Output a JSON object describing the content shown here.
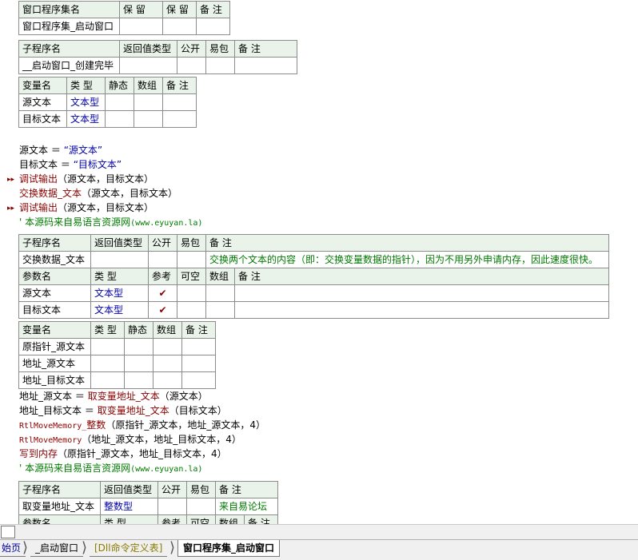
{
  "set_table": {
    "headers": [
      "窗口程序集名",
      "保 留",
      "保 留",
      "备 注"
    ],
    "row": [
      "窗口程序集_启动窗口",
      "",
      "",
      ""
    ]
  },
  "sub1": {
    "headers": [
      "子程序名",
      "返回值类型",
      "公开",
      "易包",
      "备 注"
    ],
    "row": [
      "__启动窗口_创建完毕",
      "",
      "",
      "",
      ""
    ],
    "var_headers": [
      "变量名",
      "类 型",
      "静态",
      "数组",
      "备 注"
    ],
    "vars": [
      {
        "name": "源文本",
        "type": "文本型"
      },
      {
        "name": "目标文本",
        "type": "文本型"
      }
    ]
  },
  "code1": [
    {
      "lhs": "源文本",
      "op": "＝",
      "rhs": "“源文本”"
    },
    {
      "lhs": "目标文本",
      "op": "＝",
      "rhs": "“目标文本”"
    },
    {
      "call": "调试输出",
      "args": "（源文本，目标文本）"
    },
    {
      "call": "交换数据_文本",
      "args": "（源文本，目标文本）"
    },
    {
      "call": "调试输出",
      "args": "（源文本，目标文本）"
    }
  ],
  "comment1": {
    "prefix": "' 本源码来自易语言资源网",
    "url": "(www.eyuyan.la)"
  },
  "sub2": {
    "headers": [
      "子程序名",
      "返回值类型",
      "公开",
      "易包",
      "备 注"
    ],
    "row": [
      "交换数据_文本",
      "",
      "",
      "",
      "交换两个文本的内容（即：交换变量数据的指针），因为不用另外申请内存，因此速度很快。"
    ],
    "param_headers": [
      "参数名",
      "类 型",
      "参考",
      "可空",
      "数组",
      "备 注"
    ],
    "params": [
      {
        "name": "源文本",
        "type": "文本型",
        "ref": "✔"
      },
      {
        "name": "目标文本",
        "type": "文本型",
        "ref": "✔"
      }
    ],
    "var_headers": [
      "变量名",
      "类 型",
      "静态",
      "数组",
      "备 注"
    ],
    "vars": [
      "原指针_源文本",
      "地址_源文本",
      "地址_目标文本"
    ]
  },
  "code2": [
    {
      "lhs": "地址_源文本",
      "op": "＝",
      "call": "取变量地址_文本",
      "args": "（源文本）"
    },
    {
      "lhs": "地址_目标文本",
      "op": "＝",
      "call": "取变量地址_文本",
      "args": "（目标文本）"
    },
    {
      "en": "RtlMoveMemory_",
      "call": "整数",
      "args": "（原指针_源文本，地址_源文本，4）"
    },
    {
      "en": "RtlMoveMemory",
      "args": "（地址_源文本，地址_目标文本，4）"
    },
    {
      "call": "写到内存",
      "args": "（原指针_源文本，地址_目标文本，4）"
    }
  ],
  "comment2": {
    "prefix": "' 本源码来自易语言资源网",
    "url": "(www.eyuyan.la)"
  },
  "sub3": {
    "headers": [
      "子程序名",
      "返回值类型",
      "公开",
      "易包",
      "备 注"
    ],
    "row": [
      "取变量地址_文本",
      "整数型",
      "",
      "",
      "来自易论坛"
    ],
    "param_headers": [
      "参数名",
      "类 型",
      "参考",
      "可空",
      "数组",
      "备 注"
    ]
  },
  "tabs": [
    "始页",
    "_启动窗口",
    "[Dll命令定义表]",
    "窗口程序集_启动窗口"
  ],
  "colors": {
    "header_bg": "#eaf3e9",
    "type_text": "#0000a8",
    "command": "#8b0000",
    "comment": "#007a00"
  }
}
